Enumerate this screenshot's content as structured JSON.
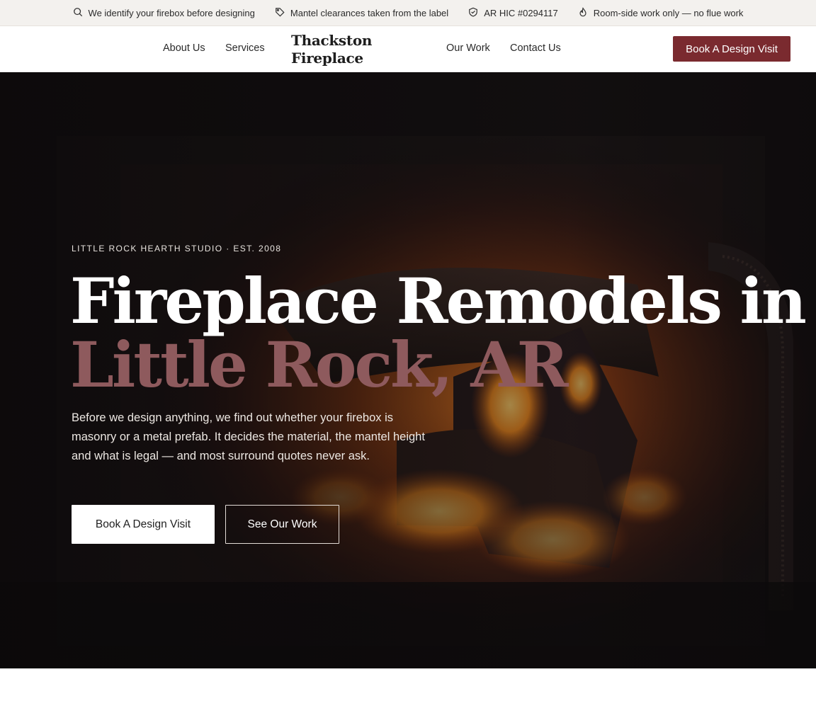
{
  "topbar": {
    "items": [
      {
        "icon": "search-icon",
        "text": "We identify your firebox before designing"
      },
      {
        "icon": "tag-icon",
        "text": "Mantel clearances taken from the label"
      },
      {
        "icon": "shield-icon",
        "text": "AR HIC #0294117"
      },
      {
        "icon": "flame-icon",
        "text": "Room-side work only — no flue work"
      }
    ]
  },
  "header": {
    "nav_left": [
      "About Us",
      "Services"
    ],
    "logo": {
      "line1": "Thackston",
      "line2": "Fireplace"
    },
    "nav_right": [
      "Our Work",
      "Contact Us"
    ],
    "cta_label": "Book A Design Visit"
  },
  "hero": {
    "eyebrow": "LITTLE ROCK HEARTH STUDIO · EST. 2008",
    "headline_line1": "Fireplace Remodels in",
    "headline_line2": "Little Rock, AR",
    "lead": "Before we design anything, we find out whether your firebox is masonry or a metal prefab. It decides the material, the mantel height and what is legal — and most surround quotes never ask.",
    "primary_cta": "Book A Design Visit",
    "secondary_cta": "See Our Work"
  },
  "colors": {
    "brand": "#7a2a2f",
    "headline_accent": "#8e5a5d",
    "topbar_bg": "#f3f1ee"
  }
}
